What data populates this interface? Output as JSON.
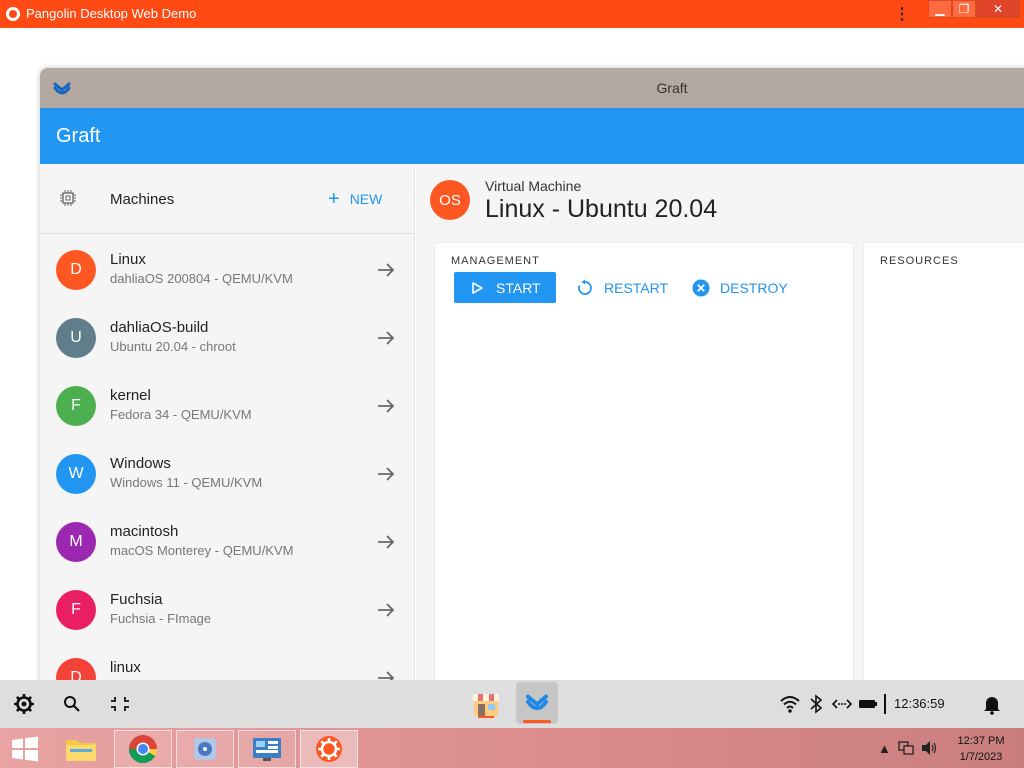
{
  "outer": {
    "title": "Pangolin Desktop Web Demo",
    "minimize": "▁",
    "maximize": "❐",
    "close": "✕"
  },
  "window": {
    "title": "Graft",
    "app_bar_title": "Graft"
  },
  "sidebar": {
    "header": "Machines",
    "new_label": "NEW",
    "items": [
      {
        "initial": "D",
        "name": "Linux",
        "subtitle": "dahliaOS 200804 - QEMU/KVM",
        "color": "#ff5722"
      },
      {
        "initial": "U",
        "name": "dahliaOS-build",
        "subtitle": "Ubuntu 20.04 - chroot",
        "color": "#607d8b"
      },
      {
        "initial": "F",
        "name": "kernel",
        "subtitle": "Fedora 34 - QEMU/KVM",
        "color": "#4caf50"
      },
      {
        "initial": "W",
        "name": "Windows",
        "subtitle": "Windows 11 - QEMU/KVM",
        "color": "#2196f3"
      },
      {
        "initial": "M",
        "name": "macintosh",
        "subtitle": "macOS Monterey - QEMU/KVM",
        "color": "#9c27b0"
      },
      {
        "initial": "F",
        "name": "Fuchsia",
        "subtitle": "Fuchsia - FImage",
        "color": "#e91e63"
      },
      {
        "initial": "D",
        "name": "linux",
        "subtitle": "",
        "color": "#f44336"
      }
    ]
  },
  "main": {
    "os_initials": "OS",
    "kind": "Virtual Machine",
    "title": "Linux - Ubuntu 20.04",
    "management_label": "MANAGEMENT",
    "resources_label": "RESOURCES",
    "start_label": "START",
    "restart_label": "RESTART",
    "destroy_label": "DESTROY"
  },
  "pangolin_bar": {
    "clock": "12:36:59"
  },
  "windows_taskbar": {
    "time": "12:37 PM",
    "date": "1/7/2023"
  },
  "colors": {
    "accent": "#2196f3",
    "outer_bar": "#ff4a14",
    "titlebar": "#b3a9a1"
  }
}
